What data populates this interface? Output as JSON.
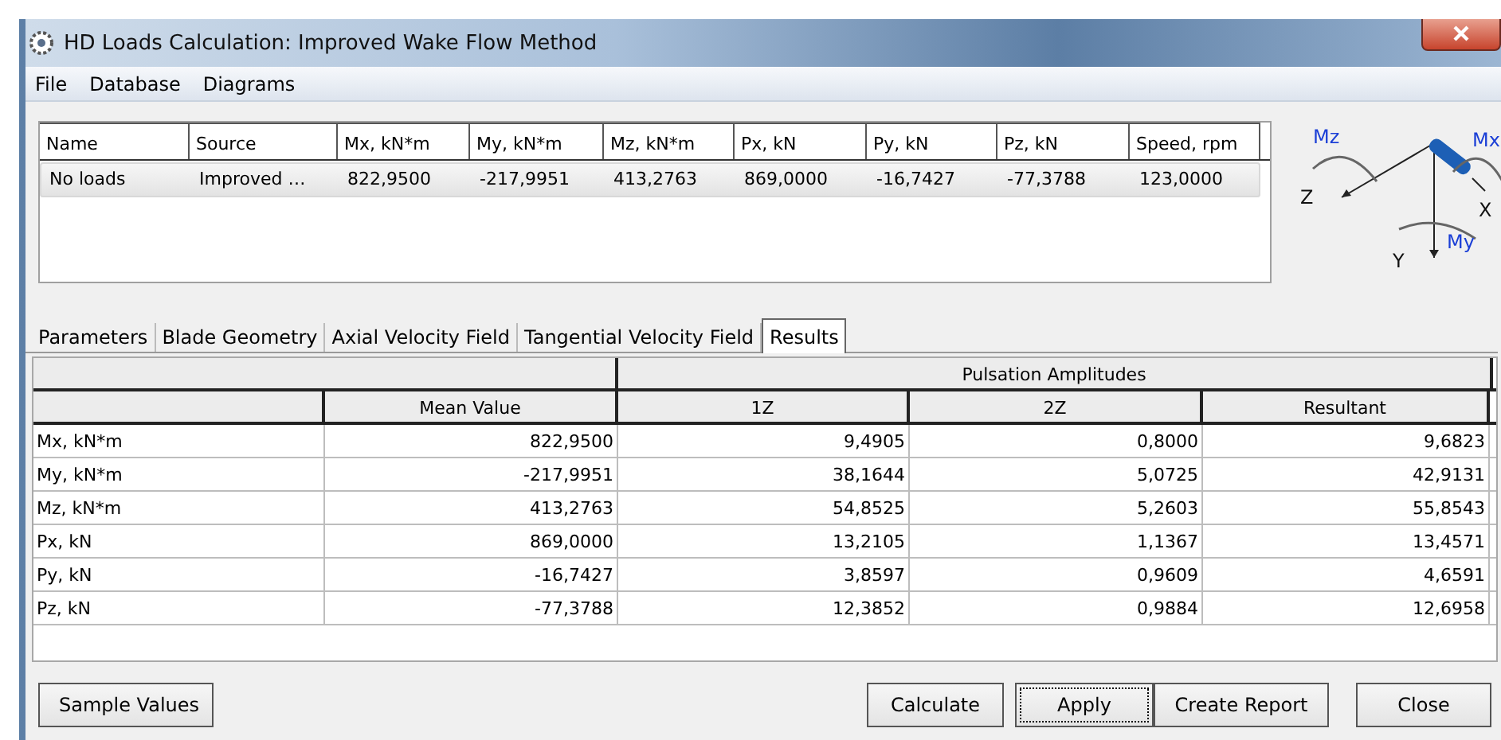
{
  "window": {
    "title": "HD Loads Calculation: Improved Wake Flow Method"
  },
  "menu": [
    "File",
    "Database",
    "Diagrams"
  ],
  "loads_table": {
    "columns": [
      "Name",
      "Source",
      "Mx, kN*m",
      "My, kN*m",
      "Mz, kN*m",
      "Px, kN",
      "Py, kN",
      "Pz, kN",
      "Speed, rpm"
    ],
    "rows": [
      {
        "cells": [
          "No loads",
          "Improved …",
          "822,9500",
          "-217,9951",
          "413,2763",
          "869,0000",
          "-16,7427",
          "-77,3788",
          "123,0000"
        ],
        "selected": true
      }
    ]
  },
  "axes_diagram": {
    "labels": [
      "Mz",
      "Mx",
      "Z",
      "X",
      "Y",
      "My"
    ]
  },
  "tabs": [
    {
      "label": "Parameters",
      "selected": false
    },
    {
      "label": "Blade Geometry",
      "selected": false
    },
    {
      "label": "Axial Velocity Field",
      "selected": false
    },
    {
      "label": "Tangential Velocity Field",
      "selected": false
    },
    {
      "label": "Results",
      "selected": true
    }
  ],
  "results_table": {
    "group_header": "Pulsation Amplitudes",
    "columns": [
      "Mean Value",
      "1Z",
      "2Z",
      "Resultant"
    ],
    "rows": [
      {
        "label": "Mx, kN*m",
        "values": [
          "822,9500",
          "9,4905",
          "0,8000",
          "9,6823"
        ]
      },
      {
        "label": "My, kN*m",
        "values": [
          "-217,9951",
          "38,1644",
          "5,0725",
          "42,9131"
        ]
      },
      {
        "label": "Mz, kN*m",
        "values": [
          "413,2763",
          "54,8525",
          "5,2603",
          "55,8543"
        ]
      },
      {
        "label": "Px, kN",
        "values": [
          "869,0000",
          "13,2105",
          "1,1367",
          "13,4571"
        ]
      },
      {
        "label": "Py, kN",
        "values": [
          "-16,7427",
          "3,8597",
          "0,9609",
          "4,6591"
        ]
      },
      {
        "label": "Pz, kN",
        "values": [
          "-77,3788",
          "12,3852",
          "0,9884",
          "12,6958"
        ]
      }
    ]
  },
  "buttons": [
    {
      "label": "Sample Values",
      "focused": false
    },
    {
      "label": "Calculate",
      "focused": false
    },
    {
      "label": "Apply",
      "focused": true
    },
    {
      "label": "Create Report",
      "focused": false
    },
    {
      "label": "Close",
      "focused": false
    }
  ]
}
